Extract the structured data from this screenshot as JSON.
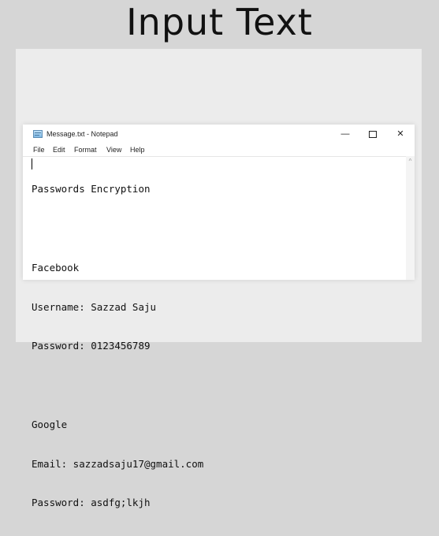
{
  "heading": "Input Text",
  "window": {
    "title": "Message.txt - Notepad",
    "minimize_glyph": "—",
    "close_glyph": "✕"
  },
  "menu": {
    "file": "File",
    "edit": "Edit",
    "format": "Format",
    "view": "View",
    "help": "Help"
  },
  "document": {
    "lines": [
      "Passwords Encryption",
      "",
      "Facebook",
      "Username: Sazzad Saju",
      "Password: 0123456789",
      "",
      "Google",
      "Email: sazzadsaju17@gmail.com",
      "Password: asdfg;lkjh"
    ]
  },
  "icons": {
    "app": "notepad-icon",
    "scroll_up": "chevron-up-icon"
  },
  "scroll_up_glyph": "^"
}
